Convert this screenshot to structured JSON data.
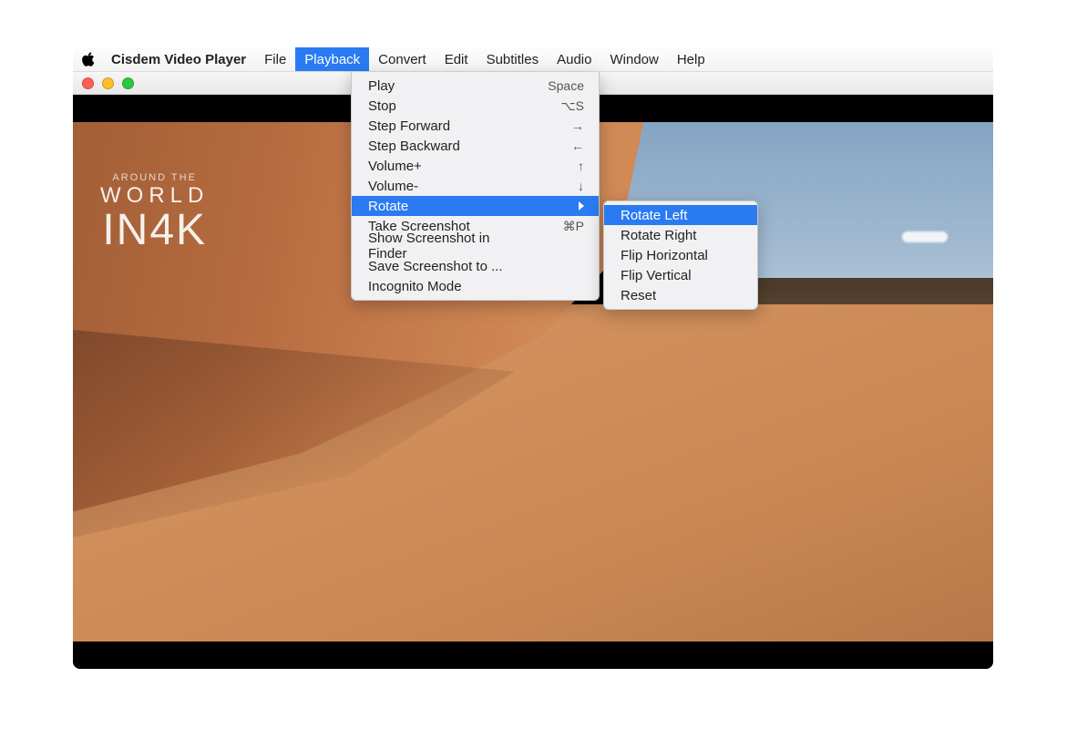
{
  "menubar": {
    "app_name": "Cisdem Video Player",
    "items": [
      "File",
      "Playback",
      "Convert",
      "Edit",
      "Subtitles",
      "Audio",
      "Window",
      "Help"
    ],
    "selected": "Playback"
  },
  "playback_menu": {
    "items": [
      {
        "label": "Play",
        "shortcut": "Space"
      },
      {
        "label": "Stop",
        "shortcut": "⌥S"
      },
      {
        "label": "Step Forward",
        "shortcut": "→"
      },
      {
        "label": "Step Backward",
        "shortcut": "←"
      },
      {
        "label": "Volume+",
        "shortcut": "↑"
      },
      {
        "label": "Volume-",
        "shortcut": "↓"
      },
      {
        "label": "Rotate",
        "shortcut": "",
        "submenu": true,
        "highlight": true
      },
      {
        "label": "Take Screenshot",
        "shortcut": "⌘P"
      },
      {
        "label": "Show Screenshot in Finder",
        "shortcut": ""
      },
      {
        "label": "Save Screenshot to ...",
        "shortcut": ""
      },
      {
        "label": "Incognito Mode",
        "shortcut": ""
      }
    ]
  },
  "rotate_submenu": {
    "items": [
      {
        "label": "Rotate Left",
        "highlight": true
      },
      {
        "label": "Rotate Right"
      },
      {
        "label": "Flip Horizontal"
      },
      {
        "label": "Flip Vertical"
      },
      {
        "label": "Reset"
      }
    ]
  },
  "watermark": {
    "line1": "AROUND THE",
    "line2": "WORLD",
    "line3_prefix": "IN",
    "line3_num": "4K"
  }
}
